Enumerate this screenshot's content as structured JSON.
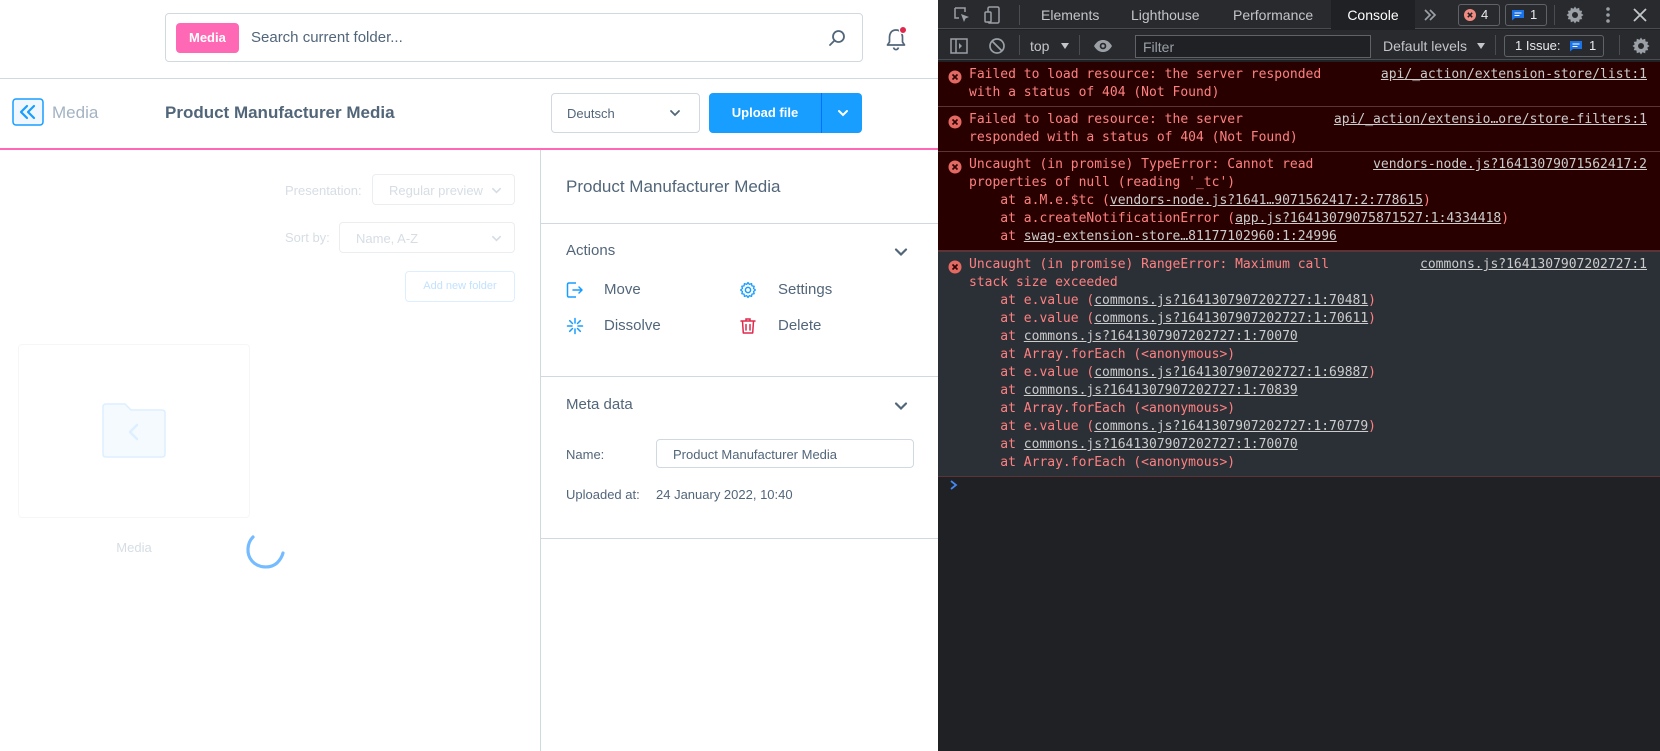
{
  "header": {
    "search_badge": "Media",
    "search_placeholder": "Search current folder..."
  },
  "smartbar": {
    "module_label": "Media",
    "title": "Product Manufacturer Media",
    "language": "Deutsch",
    "upload_label": "Upload file"
  },
  "media_pane": {
    "presentation_label": "Presentation:",
    "presentation_value": "Regular preview",
    "sort_label": "Sort by:",
    "sort_value": "Name, A-Z",
    "add_folder_label": "Add new folder",
    "folder_name": "Media"
  },
  "sidebar": {
    "title": "Product Manufacturer Media",
    "actions_title": "Actions",
    "actions": {
      "move": "Move",
      "settings": "Settings",
      "dissolve": "Dissolve",
      "delete": "Delete"
    },
    "meta_title": "Meta data",
    "name_label": "Name:",
    "name_value": "Product Manufacturer Media",
    "uploaded_label": "Uploaded at:",
    "uploaded_value": "24 January 2022, 10:40"
  },
  "devtools": {
    "tabs": [
      "Elements",
      "Lighthouse",
      "Performance",
      "Console"
    ],
    "active_tab": "Console",
    "error_count": "4",
    "message_count": "1",
    "context": "top",
    "filter_placeholder": "Filter",
    "levels": "Default levels",
    "issues_label": "1 Issue:",
    "issues_count": "1",
    "messages": [
      {
        "lines": [
          {
            "text": "Failed to load resource: the server responded",
            "src": "api/_action/extension-store/list:1"
          },
          {
            "text": "with a status of 404 (Not Found)"
          }
        ]
      },
      {
        "lines": [
          {
            "text": "Failed to load resource: the server",
            "src": "api/_action/extensio…ore/store-filters:1"
          },
          {
            "text": "responded with a status of 404 (Not Found)"
          }
        ]
      },
      {
        "lines": [
          {
            "text": "Uncaught (in promise) TypeError: Cannot read",
            "src": "vendors-node.js?16413079071562417:2"
          },
          {
            "text": "properties of null (reading '_tc')"
          },
          {
            "text": "    at a.M.e.$tc (",
            "link": "vendors-node.js?1641…9071562417:2:778615",
            "tail": ")"
          },
          {
            "text": "    at a.createNotificationError (",
            "link": "app.js?16413079075871527:1:4334418",
            "tail": ")"
          },
          {
            "text": "    at ",
            "link": "swag-extension-store…81177102960:1:24996",
            "tail": ""
          }
        ]
      },
      {
        "lines": [
          {
            "text": "Uncaught (in promise) RangeError: Maximum call",
            "src": "commons.js?1641307907202727:1"
          },
          {
            "text": "stack size exceeded"
          },
          {
            "text": "    at e.value (",
            "link": "commons.js?1641307907202727:1:70481",
            "tail": ")"
          },
          {
            "text": "    at e.value (",
            "link": "commons.js?1641307907202727:1:70611",
            "tail": ")"
          },
          {
            "text": "    at ",
            "link": "commons.js?1641307907202727:1:70070",
            "tail": ""
          },
          {
            "text": "    at Array.forEach (<anonymous>)"
          },
          {
            "text": "    at e.value (",
            "link": "commons.js?1641307907202727:1:69887",
            "tail": ")"
          },
          {
            "text": "    at ",
            "link": "commons.js?1641307907202727:1:70839",
            "tail": ""
          },
          {
            "text": "    at Array.forEach (<anonymous>)"
          },
          {
            "text": "    at e.value (",
            "link": "commons.js?1641307907202727:1:70779",
            "tail": ")"
          },
          {
            "text": "    at ",
            "link": "commons.js?1641307907202727:1:70070",
            "tail": ""
          },
          {
            "text": "    at Array.forEach (<anonymous>)"
          }
        ]
      }
    ]
  },
  "colors": {
    "brand_pink": "#ff68b4",
    "primary_blue": "#189eff",
    "error_red": "#ff8080"
  }
}
